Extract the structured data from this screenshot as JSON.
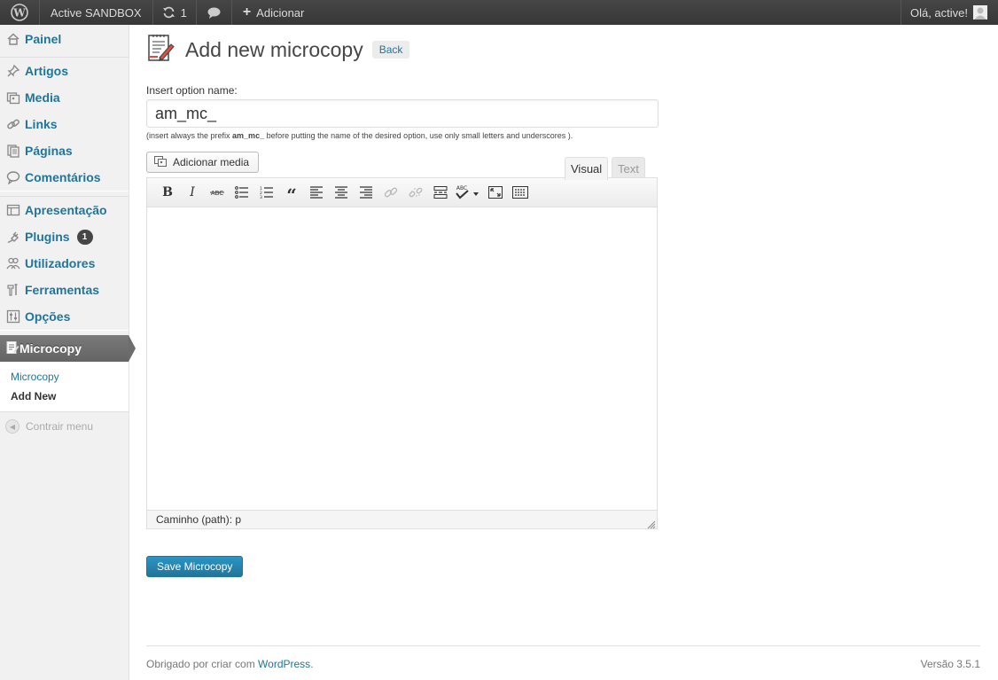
{
  "adminbar": {
    "site_name": "Active SANDBOX",
    "updates_count": "1",
    "add_label": "Adicionar",
    "greeting": "Olá, active!"
  },
  "sidebar": {
    "items": [
      {
        "label": "Painel",
        "icon": "dashboard-icon"
      },
      {
        "label": "Artigos",
        "icon": "pin-icon"
      },
      {
        "label": "Media",
        "icon": "media-icon"
      },
      {
        "label": "Links",
        "icon": "link-icon"
      },
      {
        "label": "Páginas",
        "icon": "pages-icon"
      },
      {
        "label": "Comentários",
        "icon": "comments-icon"
      },
      {
        "label": "Apresentação",
        "icon": "appearance-icon"
      },
      {
        "label": "Plugins",
        "icon": "plugin-icon",
        "badge": "1"
      },
      {
        "label": "Utilizadores",
        "icon": "users-icon"
      },
      {
        "label": "Ferramentas",
        "icon": "tools-icon"
      },
      {
        "label": "Opções",
        "icon": "settings-icon"
      }
    ],
    "current": {
      "label": "Microcopy",
      "icon": "edit-icon"
    },
    "submenu": [
      "Microcopy",
      "Add New"
    ],
    "collapse_label": "Contrair menu"
  },
  "main": {
    "title": "Add new microcopy",
    "back_label": "Back",
    "field_label": "Insert option name:",
    "option_value": "am_mc_",
    "hint_before": "(insert always the prefix ",
    "hint_prefix": "am_mc_",
    "hint_after": " before putting the name of the desired option, use only small letters and underscores ).",
    "media_button": "Adicionar media",
    "tab_visual": "Visual",
    "tab_text": "Text",
    "path_label": "Caminho (path): p",
    "save_label": "Save Microcopy"
  },
  "footer": {
    "thanks_before": "Obrigado por criar com ",
    "thanks_link": "WordPress",
    "thanks_after": ".",
    "version": "Versão 3.5.1"
  },
  "colors": {
    "link": "#21759b",
    "adminbar": "#464646",
    "primary_button": "#21759b"
  }
}
